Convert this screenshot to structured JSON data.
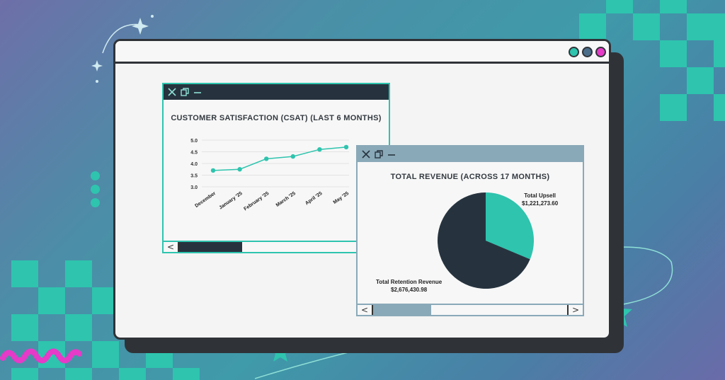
{
  "colors": {
    "accent": "#2ec4ae",
    "dark": "#26333f",
    "frame": "#2f3338",
    "pink": "#e63ac8",
    "muted": "#8aa9b8"
  },
  "window": {
    "dots": [
      {
        "name": "teal-dot",
        "color": "#2ec4ae"
      },
      {
        "name": "slate-dot",
        "color": "#4a6e8a"
      },
      {
        "name": "pink-dot",
        "color": "#e63ac8"
      }
    ]
  },
  "csat_panel": {
    "icons": [
      "close-icon",
      "copy-icon",
      "minimize-icon"
    ],
    "title": "CUSTOMER SATISFACTION (CSAT) (LAST 6 MONTHS)",
    "scroll_left": "<",
    "scroll_fraction": 0.3
  },
  "revenue_panel": {
    "icons": [
      "close-icon",
      "copy-icon",
      "minimize-icon"
    ],
    "title": "TOTAL REVENUE (ACROSS 17 MONTHS)",
    "scroll_left": "<",
    "scroll_right": ">",
    "scroll_fraction": 0.3
  },
  "chart_data": [
    {
      "type": "line",
      "title": "CUSTOMER SATISFACTION (CSAT) (LAST 6 MONTHS)",
      "categories": [
        "December",
        "January '25",
        "February '25",
        "March '25",
        "April '25",
        "May '25"
      ],
      "values": [
        3.7,
        3.75,
        4.2,
        4.3,
        4.6,
        4.7
      ],
      "yticks": [
        "5.0",
        "4.5",
        "4.0",
        "3.5",
        "3.0"
      ],
      "ylim": [
        3.0,
        5.0
      ],
      "grid": true,
      "color": "#2ec4ae"
    },
    {
      "type": "pie",
      "title": "TOTAL REVENUE (ACROSS 17 MONTHS)",
      "slices": [
        {
          "label": "Total Upsell",
          "value_label": "$1,221,273.60",
          "value": 1221273.6,
          "color": "#2ec4ae"
        },
        {
          "label": "Total Retention Revenue",
          "value_label": "$2,676,430.98",
          "value": 2676430.98,
          "color": "#26333f"
        }
      ]
    }
  ]
}
